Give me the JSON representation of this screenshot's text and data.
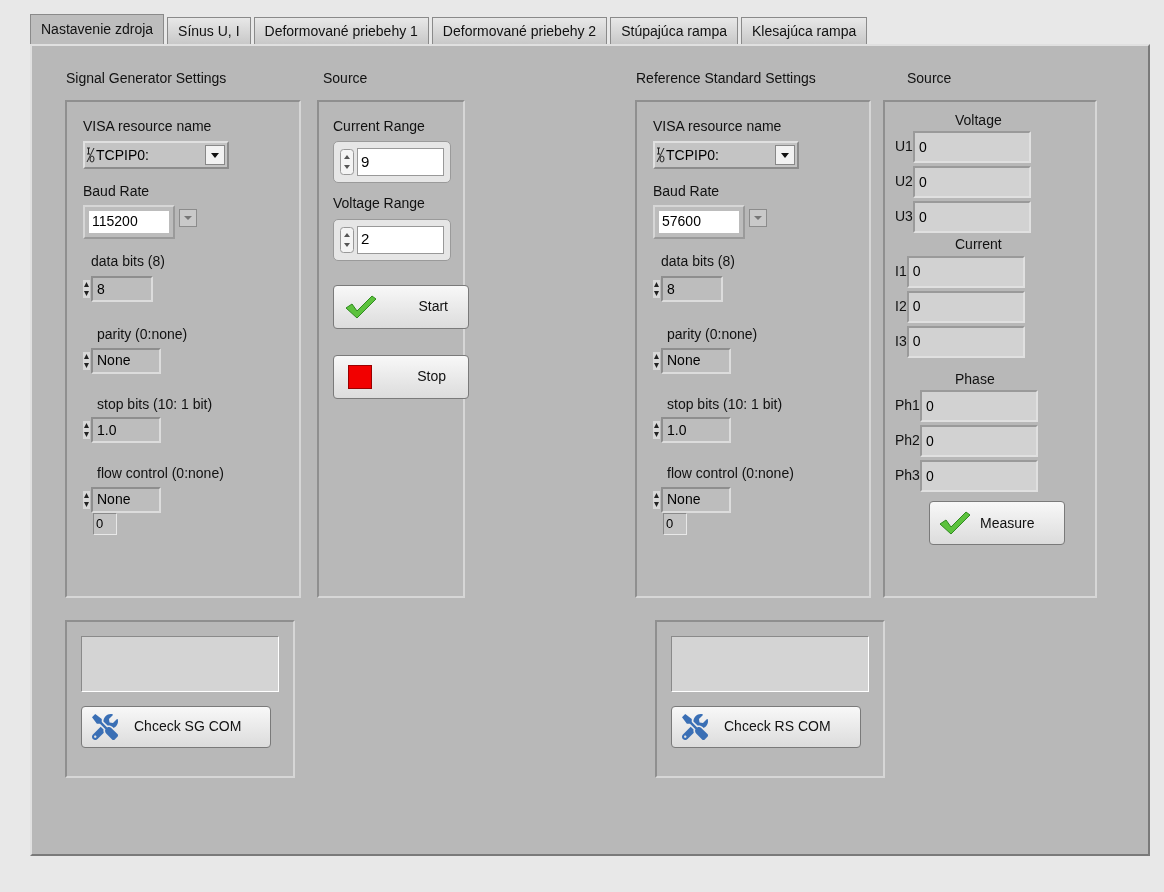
{
  "tabs": [
    {
      "label": "Nastavenie zdroja",
      "selected": true
    },
    {
      "label": "Sínus U, I",
      "selected": false
    },
    {
      "label": "Deformované priebehy 1",
      "selected": false
    },
    {
      "label": "Deformované priebehy 2",
      "selected": false
    },
    {
      "label": "Stúpajúca rampa",
      "selected": false
    },
    {
      "label": "Klesajúca rampa",
      "selected": false
    }
  ],
  "serial_panels": [
    {
      "title": "Signal Generator Settings",
      "visa_label": "VISA resource name",
      "visa_value": "TCPIP0:",
      "baud_label": "Baud Rate",
      "baud_value": "115200",
      "data_bits_label": "data bits (8)",
      "data_bits_value": "8",
      "parity_label": "parity (0:none)",
      "parity_value": "None",
      "stop_bits_label": "stop bits (10: 1 bit)",
      "stop_bits_value": "1.0",
      "flow_label": "flow control (0:none)",
      "flow_value": "None",
      "flow_code": "0",
      "check_button": "Chceck SG COM"
    },
    {
      "title": "Reference Standard Settings",
      "visa_label": "VISA resource name",
      "visa_value": "TCPIP0:",
      "baud_label": "Baud Rate",
      "baud_value": "57600",
      "data_bits_label": "data bits (8)",
      "data_bits_value": "8",
      "parity_label": "parity (0:none)",
      "parity_value": "None",
      "stop_bits_label": "stop bits (10: 1 bit)",
      "stop_bits_value": "1.0",
      "flow_label": "flow control (0:none)",
      "flow_value": "None",
      "flow_code": "0",
      "check_button": "Chceck RS COM"
    }
  ],
  "source": {
    "title": "Source",
    "current_label": "Current Range",
    "current_value": "9",
    "voltage_label": "Voltage Range",
    "voltage_value": "2",
    "start_button": "Start",
    "stop_button": "Stop"
  },
  "measurement": {
    "title": "Source",
    "groups": [
      {
        "heading": "Voltage",
        "rows": [
          {
            "label": "U1",
            "value": "0"
          },
          {
            "label": "U2",
            "value": "0"
          },
          {
            "label": "U3",
            "value": "0"
          }
        ]
      },
      {
        "heading": "Current",
        "rows": [
          {
            "label": "I1",
            "value": "0"
          },
          {
            "label": "I2",
            "value": "0"
          },
          {
            "label": "I3",
            "value": "0"
          }
        ]
      },
      {
        "heading": "Phase",
        "rows": [
          {
            "label": "Ph1",
            "value": "0"
          },
          {
            "label": "Ph2",
            "value": "0"
          },
          {
            "label": "Ph3",
            "value": "0"
          }
        ]
      }
    ],
    "measure_button": "Measure"
  }
}
